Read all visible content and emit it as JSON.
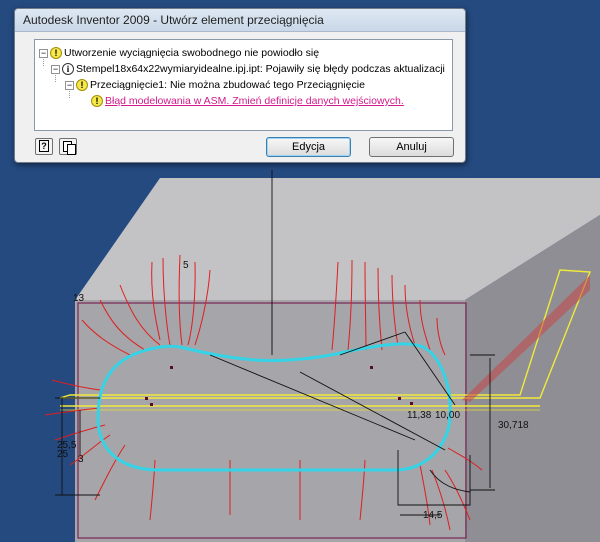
{
  "dialog": {
    "title": "Autodesk Inventor 2009 - Utwórz element przeciągnięcia",
    "tree": [
      {
        "text": "Utworzenie wyciągnięcia swobodnego nie powiodło się",
        "icon": "warning"
      },
      {
        "text": "Stempel18x64x22wymiaryidealne.ipj.ipt: Pojawiły się błędy podczas aktualizacji",
        "icon": "info"
      },
      {
        "text": "Przeciągnięcie1: Nie można zbudować tego Przeciągnięcie",
        "icon": "warning"
      },
      {
        "text": "Błąd modelowania w ASM. Zmień definicje danych wejściowych.",
        "icon": "warning",
        "link": true
      }
    ],
    "buttons": {
      "edit": "Edycja",
      "cancel": "Anuluj"
    }
  },
  "viewport": {
    "dimensions": [
      "5",
      "13",
      "11,38",
      "10,00",
      "30,718",
      "25,5",
      "25",
      "3",
      "14,5"
    ],
    "colors": {
      "background": "#244a80",
      "profile": "#35d3e6",
      "normals": "#e01e1e",
      "plane": "#f2ea3a"
    }
  }
}
